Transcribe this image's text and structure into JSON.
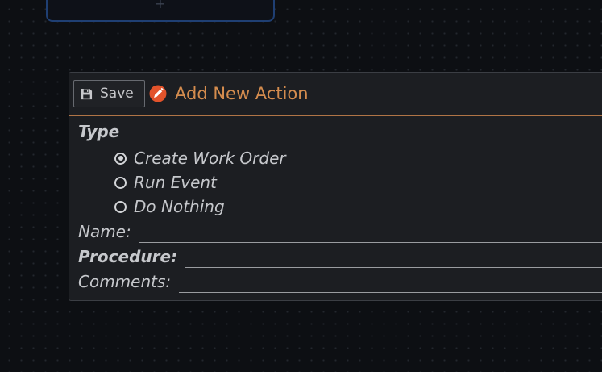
{
  "top_card": {
    "plus_glyph": "+"
  },
  "form": {
    "save_label": "Save",
    "title": "Add New Action",
    "type_label": "Type",
    "type_options": [
      {
        "label": "Create Work Order",
        "checked": true
      },
      {
        "label": "Run Event",
        "checked": false
      },
      {
        "label": "Do Nothing",
        "checked": false
      }
    ],
    "name_label": "Name:",
    "name_value": "",
    "procedure_label": "Procedure:",
    "procedure_value": "",
    "comments_label": "Comments:",
    "comments_value": ""
  },
  "colors": {
    "background": "#0d0f13",
    "panel": "#1c1e22",
    "accent": "#d48c4e",
    "edit_icon": "#e2532b",
    "top_card_border": "#1f3f73"
  },
  "icons": {
    "save": "floppy-disk-icon",
    "title": "edit-pencil-icon"
  }
}
